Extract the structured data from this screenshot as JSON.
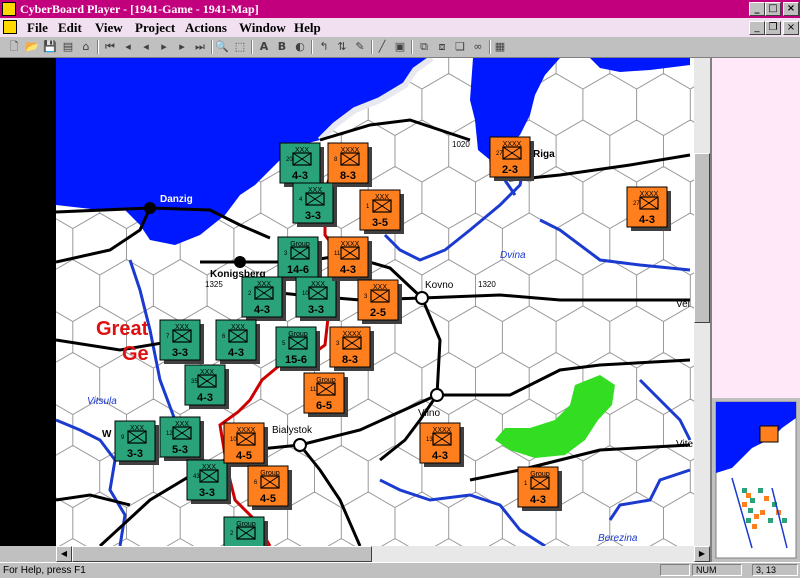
{
  "window": {
    "title": "CyberBoard Player - [1941-Game - 1941-Map]",
    "minimize": "_",
    "maximize": "□",
    "close": "×"
  },
  "menubar": {
    "items": [
      "File",
      "Edit",
      "View",
      "Project",
      "Actions",
      "Window",
      "Help"
    ],
    "accel": [
      "F",
      "E",
      "V",
      "P",
      "A",
      "W",
      "H"
    ]
  },
  "toolbar": {
    "icons": [
      "new-icon",
      "open-icon",
      "save-icon",
      "print-icon",
      "record-icon",
      "first-move-icon",
      "prev-move-icon",
      "step-back-icon",
      "play-icon",
      "step-forward-icon",
      "last-move-icon",
      "zoom-icon",
      "select-icon",
      "text-a-icon",
      "text-b-icon",
      "color-icon",
      "rotate-icon",
      "flip-icon",
      "plot-icon",
      "line-icon",
      "measure-icon",
      "grid-icon"
    ],
    "labels": [
      "A",
      "B"
    ]
  },
  "map": {
    "cities": [
      "Danzig",
      "Konigsberg",
      "Kovno",
      "Vilno",
      "Bialystok",
      "Riga"
    ],
    "rivers": [
      "Dvina",
      "Vitsula",
      "Berezina"
    ],
    "hexnums": [
      "1020",
      "1325",
      "1320"
    ],
    "edge_labels": [
      "Vel",
      "Vite",
      "W"
    ],
    "region_text": [
      "Great",
      "Ge"
    ],
    "colors": {
      "water": "#0018ff",
      "german": "#2aa37a",
      "soviet": "#ff7f1f",
      "forest": "#33dd22",
      "road": "#000000",
      "border": "#cc0000",
      "river": "#1a3ad0"
    },
    "german_units": [
      {
        "type": "XXX",
        "value": "4-3",
        "id": "20"
      },
      {
        "type": "XXX",
        "value": "3-3",
        "id": "4"
      },
      {
        "type": "Group",
        "value": "14-6",
        "id": "3"
      },
      {
        "type": "XXX",
        "value": "4-3",
        "id": "2"
      },
      {
        "type": "XXX",
        "value": "3-3",
        "id": "10"
      },
      {
        "type": "XXX",
        "value": "3-3",
        "id": "7"
      },
      {
        "type": "XXX",
        "value": "4-3",
        "id": "6"
      },
      {
        "type": "Group",
        "value": "15-6",
        "id": "5"
      },
      {
        "type": "XXX",
        "value": "4-3",
        "id": "35"
      },
      {
        "type": "XXX",
        "value": "3-3",
        "id": "9"
      },
      {
        "type": "XXX",
        "value": "5-3",
        "id": "12"
      },
      {
        "type": "XXX",
        "value": "3-3",
        "id": "43"
      },
      {
        "type": "Group",
        "value": "",
        "id": "2"
      }
    ],
    "soviet_units": [
      {
        "type": "XXXX",
        "value": "8-3",
        "id": "8"
      },
      {
        "type": "XXXX",
        "value": "2-3",
        "id": "27"
      },
      {
        "type": "XXX",
        "value": "3-5",
        "id": "1"
      },
      {
        "type": "XXXX",
        "value": "4-3",
        "id": "27"
      },
      {
        "type": "XXXX",
        "value": "4-3",
        "id": "11"
      },
      {
        "type": "XXX",
        "value": "2-5",
        "id": "3"
      },
      {
        "type": "XXXX",
        "value": "8-3",
        "id": "3"
      },
      {
        "type": "Group",
        "value": "6-5",
        "id": "11"
      },
      {
        "type": "XXXX",
        "value": "4-5",
        "id": "10"
      },
      {
        "type": "XXXX",
        "value": "4-3",
        "id": "13"
      },
      {
        "type": "Group",
        "value": "4-5",
        "id": "6"
      },
      {
        "type": "Group",
        "value": "4-3",
        "id": "1"
      }
    ]
  },
  "status": {
    "help": "For Help, press F1",
    "num": "NUM",
    "coords": "3, 13"
  }
}
